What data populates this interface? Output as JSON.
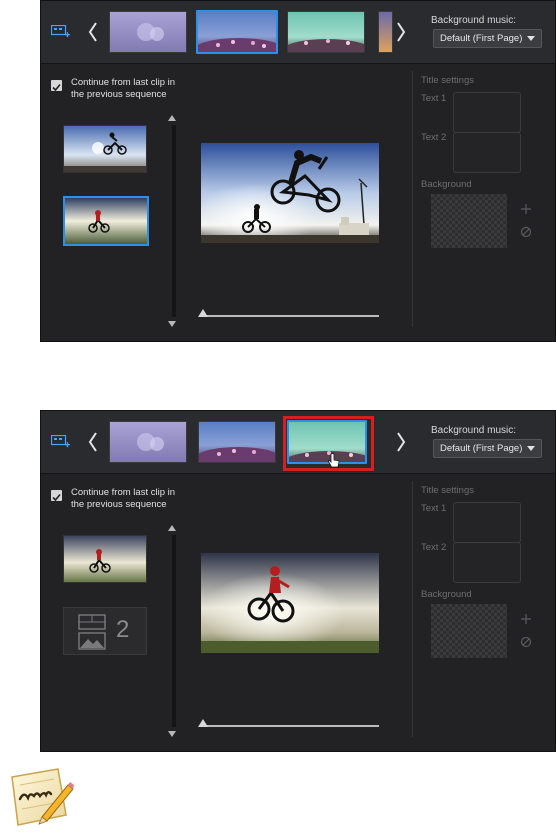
{
  "panels": [
    {
      "background_music_label": "Background music:",
      "background_music_value": "Default (First Page)",
      "continue_text": "Continue from last clip in the previous sequence",
      "title_settings_label": "Title settings",
      "text1_label": "Text 1",
      "text2_label": "Text 2",
      "background_label": "Background"
    },
    {
      "background_music_label": "Background music:",
      "background_music_value": "Default (First Page)",
      "continue_text": "Continue from last clip in the previous sequence",
      "title_settings_label": "Title settings",
      "text1_label": "Text 1",
      "text2_label": "Text 2",
      "background_label": "Background",
      "placeholder_number": "2"
    }
  ],
  "icons": {
    "storyboard": "storyboard-icon",
    "prev": "chevron-left-icon",
    "next": "chevron-right-icon",
    "add": "plus-icon",
    "none": "no-background-icon",
    "cursor": "hand-cursor-icon",
    "note": "note-pencil-icon"
  },
  "colors": {
    "selection_blue": "#2c8fe8",
    "highlight_red": "#d42020",
    "panel_bg": "#222224"
  }
}
